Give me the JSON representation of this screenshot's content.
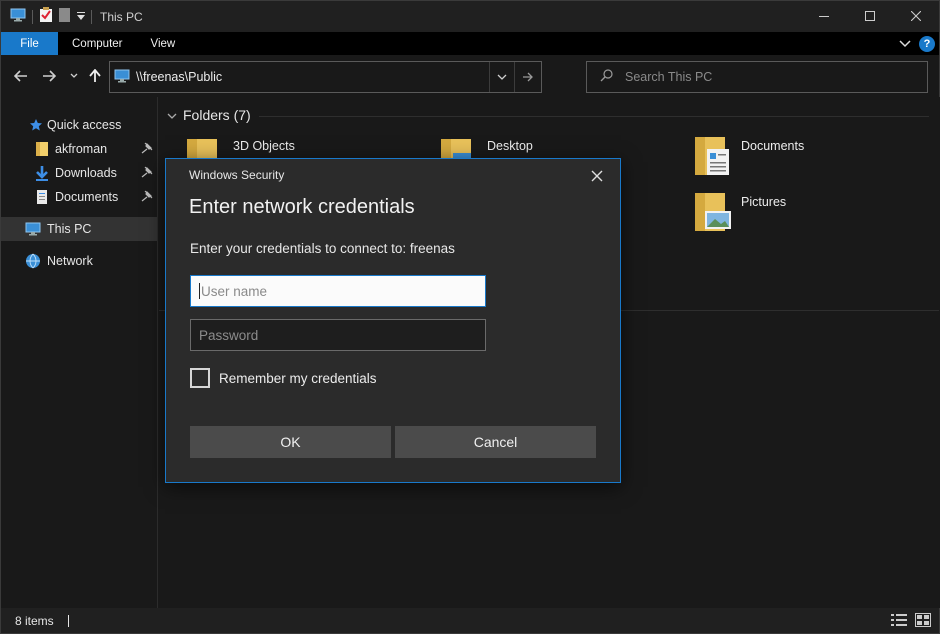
{
  "window": {
    "title": "This PC",
    "controls": {
      "minimize": "–",
      "maximize": "□",
      "close": "✕"
    }
  },
  "ribbon": {
    "tabs": [
      "File",
      "Computer",
      "View"
    ]
  },
  "navigation": {
    "address": "\\\\freenas\\Public",
    "search_placeholder": "Search This PC"
  },
  "sidebar": {
    "items": [
      {
        "label": "Quick access",
        "icon": "star-icon",
        "pinned": false
      },
      {
        "label": "akfroman",
        "icon": "folder-icon",
        "pinned": true
      },
      {
        "label": "Downloads",
        "icon": "download-arrow-icon",
        "pinned": true
      },
      {
        "label": "Documents",
        "icon": "document-icon",
        "pinned": true
      },
      {
        "label": "This PC",
        "icon": "computer-icon",
        "pinned": false,
        "selected": true
      },
      {
        "label": "Network",
        "icon": "network-icon",
        "pinned": false
      }
    ]
  },
  "main": {
    "group_header": "Folders (7)",
    "folders": [
      "3D Objects",
      "Desktop",
      "Documents",
      "Pictures"
    ]
  },
  "status": {
    "item_count": "8 items"
  },
  "dialog": {
    "caption": "Windows Security",
    "title": "Enter network credentials",
    "message": "Enter your credentials to connect to: freenas",
    "username_placeholder": "User name",
    "password_placeholder": "Password",
    "remember_label": "Remember my credentials",
    "remember_checked": false,
    "ok_label": "OK",
    "cancel_label": "Cancel"
  },
  "colors": {
    "accent": "#1979ca",
    "background": "#191919",
    "dialog_bg": "#2b2b2b",
    "folder_yellow": "#e8c15a"
  }
}
